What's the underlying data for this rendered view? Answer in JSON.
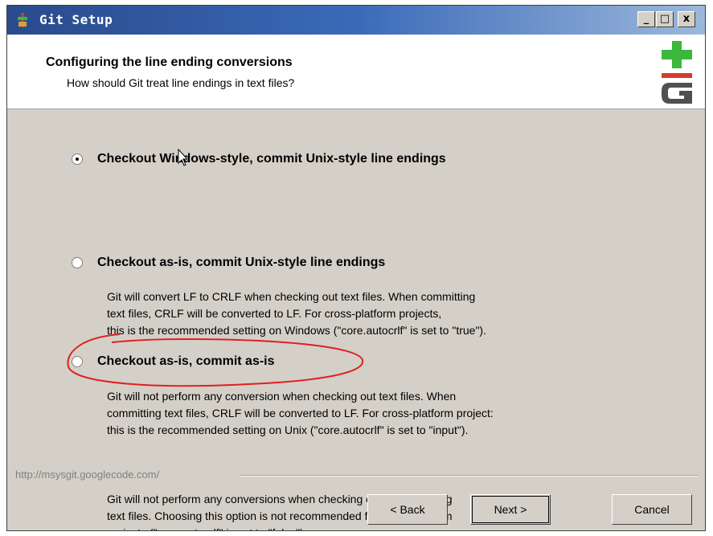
{
  "window": {
    "title": "Git Setup",
    "controls": {
      "minimize": "_",
      "maximize": "□",
      "close": "x"
    }
  },
  "header": {
    "title": "Configuring the line ending conversions",
    "subtitle": "How should Git treat line endings in text files?"
  },
  "options": [
    {
      "label": "Checkout Windows-style, commit Unix-style line endings",
      "selected": true,
      "description": [
        "Git will convert LF to CRLF when checking out text files. When committing",
        "text files, CRLF will be converted to LF. For cross-platform projects,",
        "this is the recommended setting on Windows (\"core.autocrlf\" is set to \"true\")."
      ]
    },
    {
      "label": "Checkout as-is, commit Unix-style line endings",
      "selected": false,
      "description": [
        "Git will not perform any conversion when checking out text files. When",
        "committing text files, CRLF will be converted to LF. For cross-platform project:",
        "this is the recommended setting on Unix (\"core.autocrlf\" is set to \"input\")."
      ]
    },
    {
      "label": "Checkout as-is, commit as-is",
      "selected": false,
      "description": [
        "Git will not perform any conversions when checking out or committing",
        "text files. Choosing this option is not recommended for cross-platform",
        "projects (\"core.autocrlf\" is set to \"false\")."
      ]
    }
  ],
  "footer": {
    "link": "http://msysgit.googlecode.com/"
  },
  "buttons": {
    "back": "< Back",
    "next": "Next >",
    "cancel": "Cancel"
  },
  "colors": {
    "dialog_bg": "#d4d0c8",
    "titlebar": "#2a4a8c",
    "annotation": "#e02020",
    "logo_green": "#3cb83c",
    "logo_red": "#d83a2a"
  }
}
